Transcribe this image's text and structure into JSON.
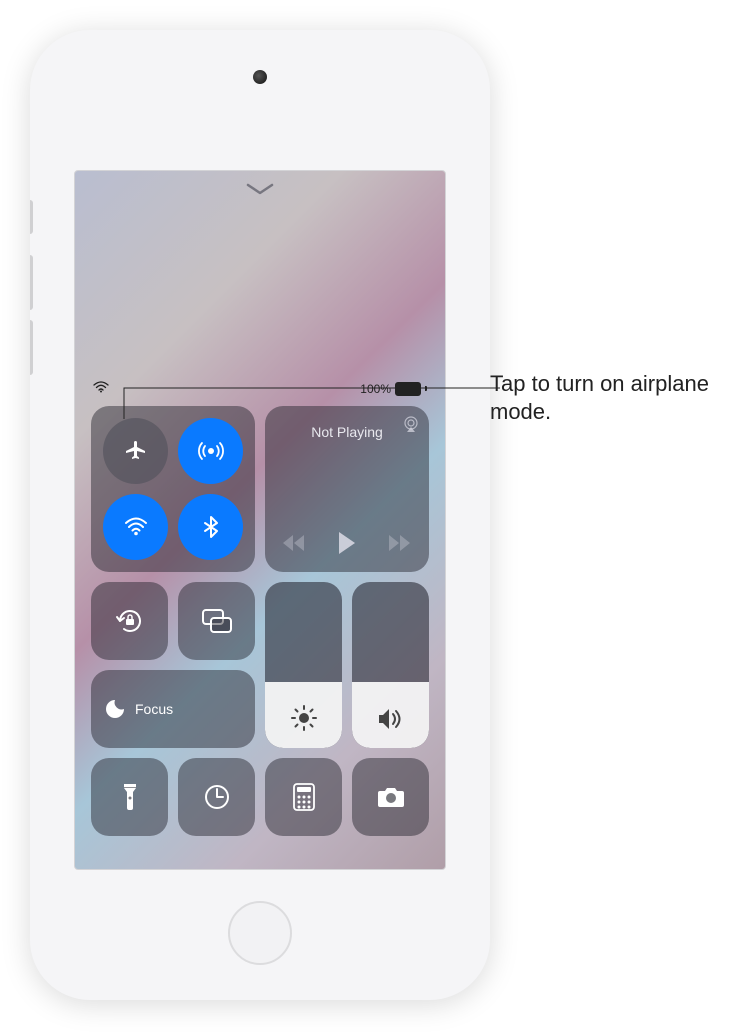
{
  "status": {
    "battery_text": "100%"
  },
  "connectivity": {
    "airplane_mode": {
      "on": false
    },
    "airdrop": {
      "on": true
    },
    "wifi": {
      "on": true
    },
    "bluetooth": {
      "on": true
    }
  },
  "now_playing": {
    "title": "Not Playing"
  },
  "focus": {
    "label": "Focus"
  },
  "sliders": {
    "brightness_percent": 40,
    "volume_percent": 40
  },
  "callout": {
    "text": "Tap to turn on airplane mode."
  }
}
